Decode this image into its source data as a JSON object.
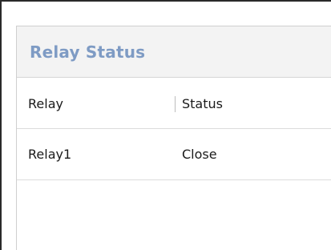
{
  "panel": {
    "title": "Relay Status"
  },
  "table": {
    "columns": [
      "Relay",
      "Status"
    ],
    "rows": [
      {
        "relay": "Relay1",
        "status": "Close"
      }
    ]
  }
}
